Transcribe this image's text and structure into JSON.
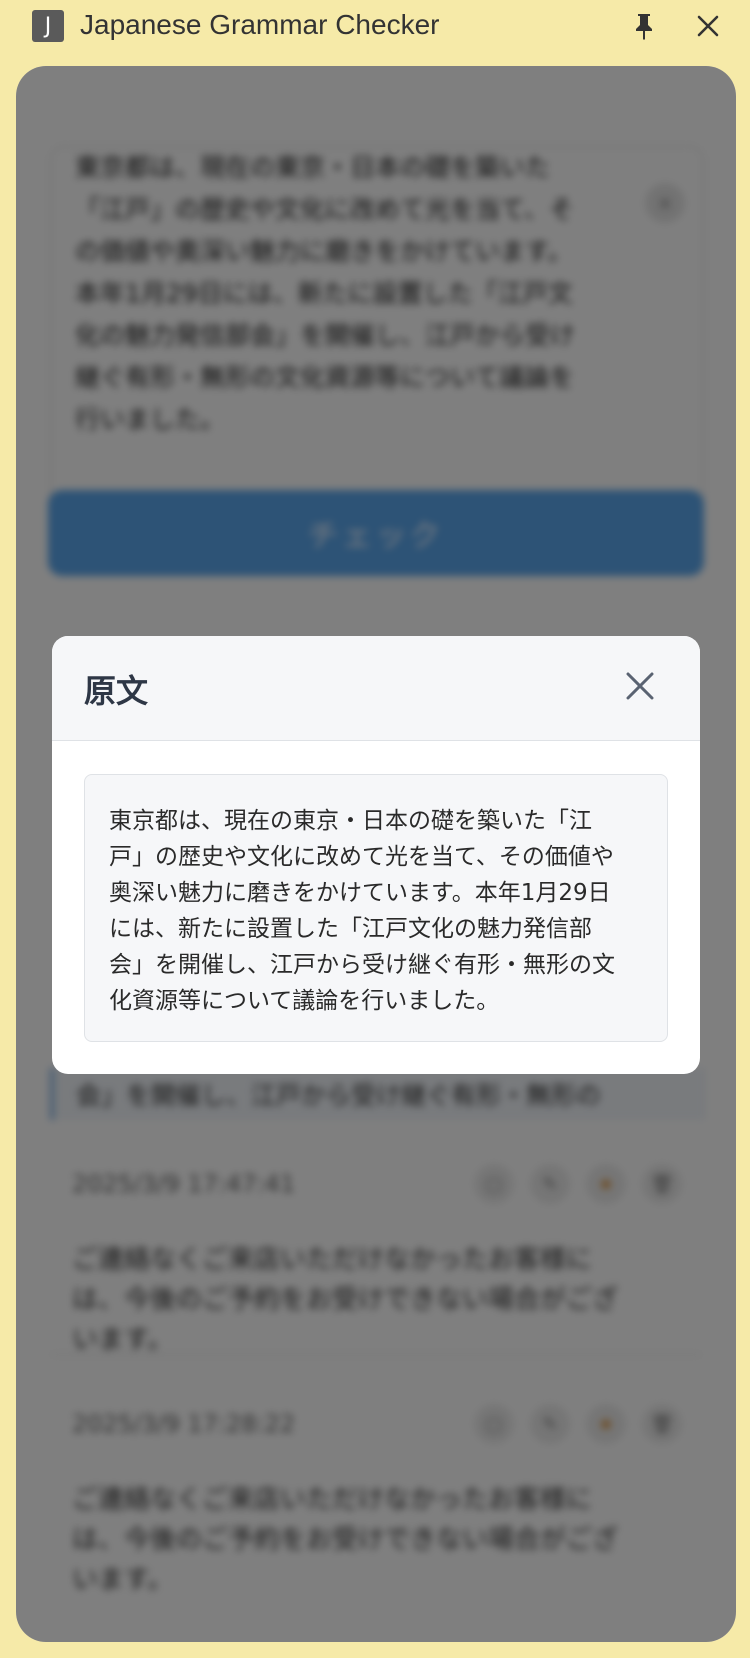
{
  "window": {
    "icon_letter": "J",
    "title": "Japanese Grammar Checker",
    "pin_icon": "pin-icon",
    "close_icon": "close-icon"
  },
  "input": {
    "text_lines": "東京都は、現在の東京・日本の礎を築いた\n「江戸」の歴史や文化に改めて光を当て、そ\nの価値や奥深い魅力に磨きをかけています。\n本年1月29日には、新たに設置した「江戸文\n化の魅力発信部会」を開催し、江戸から受け\n継ぐ有形・無形の文化資源等について議論を\n行いました。"
  },
  "check_button": {
    "label": "チェック"
  },
  "history": {
    "highlight_text": "会」を開催し、江戸から受け継ぐ有形・無形の",
    "items": [
      {
        "date": "2025/3/9 17:47:41",
        "text": "ご連絡なくご来店いただけなかったお客様に\nは、今後のご予約をお受けできない場合がござ\nいます。"
      },
      {
        "date": "2025/3/9 17:28:22",
        "text": "ご連絡なくご来店いただけなかったお客様に\nは、今後のご予約をお受けできない場合がござ\nいます。"
      }
    ]
  },
  "modal": {
    "title": "原文",
    "body": "東京都は、現在の東京・日本の礎を築いた「江\n戸」の歴史や文化に改めて光を当て、その価値や\n奥深い魅力に磨きをかけています。本年1月29日\nには、新たに設置した「江戸文化の魅力発信部\n会」を開催し、江戸から受け継ぐ有形・無形の文\n化資源等について議論を行いました。"
  }
}
